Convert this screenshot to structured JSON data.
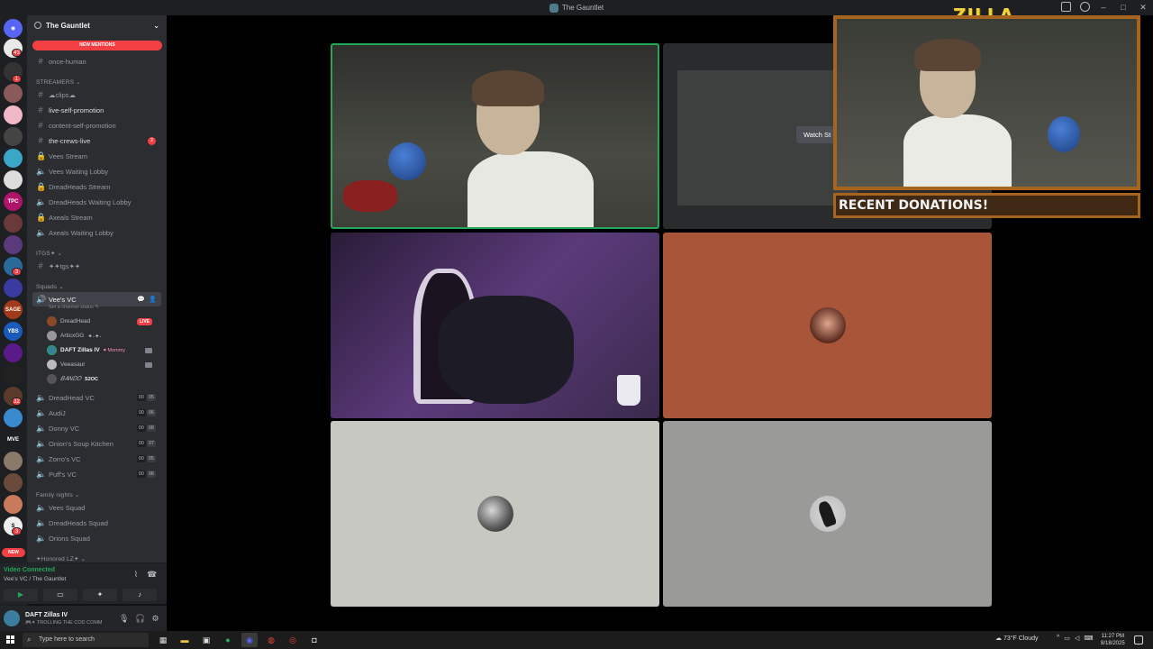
{
  "window": {
    "title": "The Gauntlet"
  },
  "server": {
    "name": "The Gauntlet",
    "new_mentions": "NEW MENTIONS"
  },
  "rail": {
    "badges": [
      "43",
      "1",
      "3",
      "1",
      "3",
      "2",
      "32",
      "3"
    ],
    "labels": [
      "TPC",
      "YBS",
      "MVE",
      "SAGE"
    ],
    "new_label": "NEW"
  },
  "channels": {
    "top": {
      "name": "once-human"
    },
    "categories": {
      "streamers": "STREAMERS",
      "itgs": "ITGS✦",
      "squads": "Squads",
      "family": "Family nights",
      "honored": "✦Honored LZ✦"
    },
    "streamers": [
      {
        "name": "☁clips☁",
        "type": "text"
      },
      {
        "name": "live-self-promotion",
        "type": "text"
      },
      {
        "name": "content-self-promotion",
        "type": "text"
      },
      {
        "name": "the-crews-live",
        "type": "text",
        "badge": "2"
      },
      {
        "name": "Vees Stream",
        "type": "voice"
      },
      {
        "name": "Vees Waiting Lobby",
        "type": "voice"
      },
      {
        "name": "DreadHeads Stream",
        "type": "voice"
      },
      {
        "name": "DreadHeads Waiting Lobby",
        "type": "voice"
      },
      {
        "name": "Axeals Stream",
        "type": "voice"
      },
      {
        "name": "Axeals Waiting Lobby",
        "type": "voice"
      }
    ],
    "itgs_channel": "✦✦tgs✦✦",
    "active_vc": {
      "name": "Vee's VC",
      "status_hint": "Set a channel status"
    },
    "members": [
      {
        "name": "DreadHead",
        "tag": "LIVE"
      },
      {
        "name": "ArticxGG",
        "tag": "✦-✦-"
      },
      {
        "name": "DAFT Zillas IV",
        "tag": "♥ Mommy"
      },
      {
        "name": "Veeasaur",
        "tag": ""
      },
      {
        "name": "𝐵𝐴𝑁𝐷𝑂",
        "tag": "S2OC"
      }
    ],
    "voice_channels": [
      {
        "name": "DreadHead VC",
        "a": "00",
        "b": "05"
      },
      {
        "name": "AudiJ",
        "a": "00",
        "b": "06"
      },
      {
        "name": "Donny VC",
        "a": "00",
        "b": "08"
      },
      {
        "name": "Onion's Soup Kitchen",
        "a": "00",
        "b": "07"
      },
      {
        "name": "Zorro's VC",
        "a": "00",
        "b": "05"
      },
      {
        "name": "Puff's VC",
        "a": "00",
        "b": "06"
      }
    ],
    "family": [
      {
        "name": "Vees Squad"
      },
      {
        "name": "DreadHeads Squad"
      },
      {
        "name": "Orions Squad"
      }
    ]
  },
  "voice": {
    "status": "Video Connected",
    "where": "Vee's VC / The Gauntlet"
  },
  "user": {
    "name": "DAFT Zillas IV",
    "status": "🎮✦ TROLLING THE COD COMM"
  },
  "stage": {
    "watch_label": "Watch St"
  },
  "overlay": {
    "brand": "ZILLA",
    "donations": "RECENT DONATIONS!"
  },
  "taskbar": {
    "search_placeholder": "Type here to search",
    "weather": "73°F  Cloudy",
    "time": "11:27 PM",
    "date": "8/18/2025"
  },
  "colors": {
    "accent_red": "#f23f43",
    "connected_green": "#23a55a",
    "overlay_frame": "#a5651e"
  }
}
